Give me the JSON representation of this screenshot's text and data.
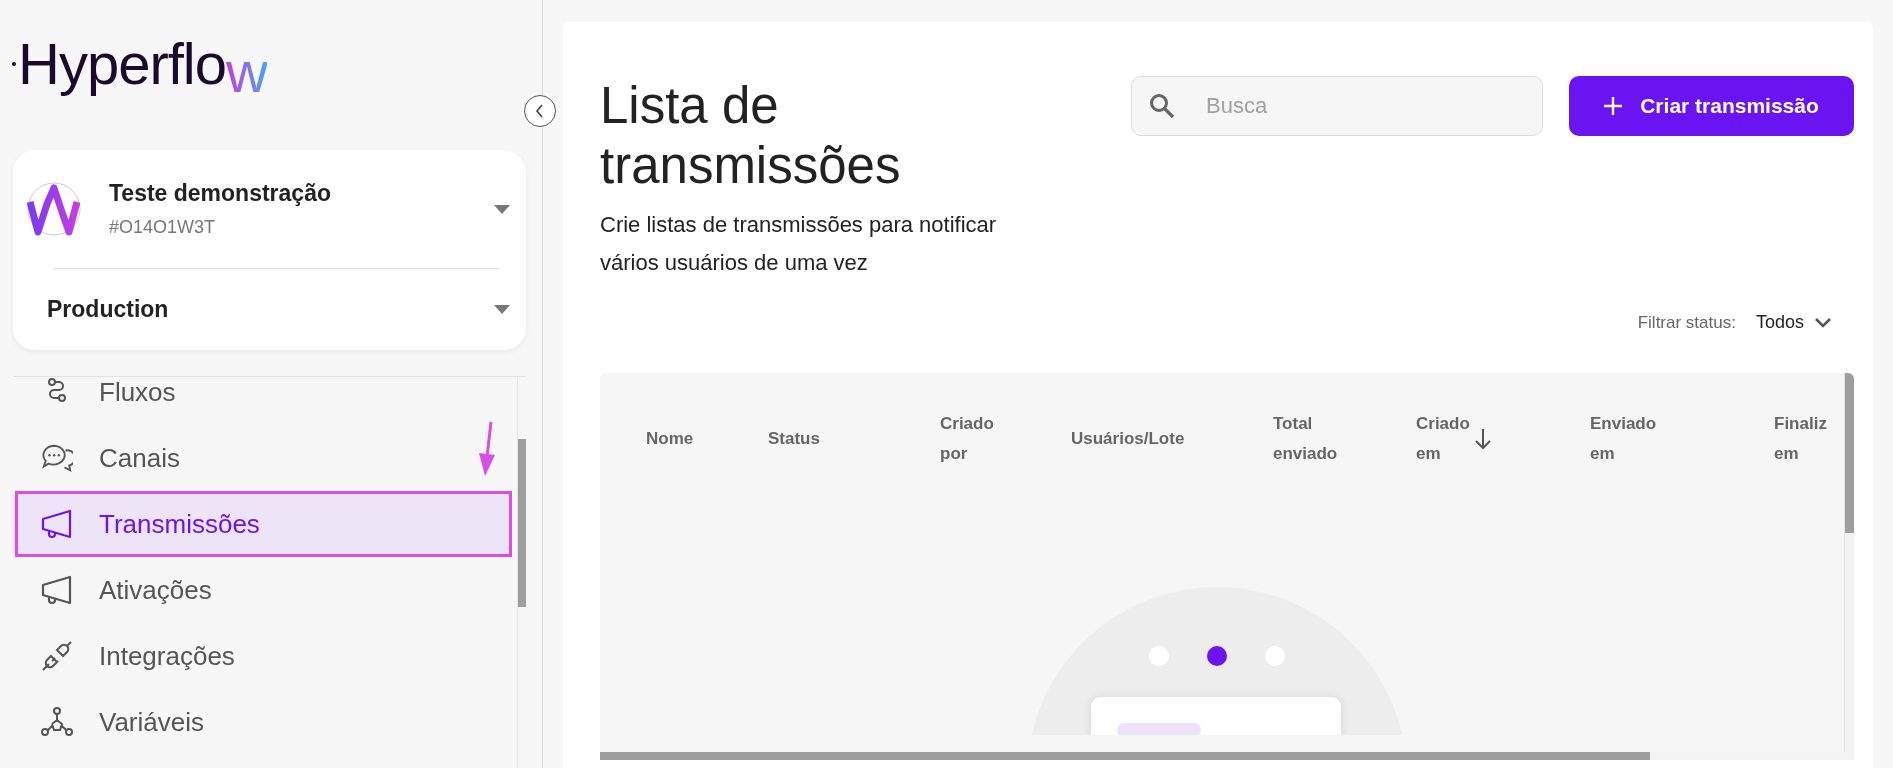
{
  "logo": {
    "text": "Hyperflow"
  },
  "organization": {
    "name": "Teste demonstração",
    "code": "#O14O1W3T",
    "environment": "Production"
  },
  "nav": [
    {
      "label": "Fluxos",
      "kind": "flow",
      "selected": false,
      "annotated": false
    },
    {
      "label": "Canais",
      "kind": "chat",
      "selected": false,
      "annotated": false
    },
    {
      "label": "Transmissões",
      "kind": "megaphone",
      "selected": true,
      "annotated": true
    },
    {
      "label": "Ativações",
      "kind": "megaphone",
      "selected": false,
      "annotated": false
    },
    {
      "label": "Integrações",
      "kind": "plug",
      "selected": false,
      "annotated": false
    },
    {
      "label": "Variáveis",
      "kind": "nodes",
      "selected": false,
      "annotated": false
    }
  ],
  "page": {
    "title": "Lista de transmissões",
    "subtitle": "Crie listas de transmissões para notificar vários usuários de uma vez"
  },
  "search": {
    "placeholder": "Busca"
  },
  "create_button": {
    "label": "Criar transmissão"
  },
  "filter": {
    "label": "Filtrar status:",
    "value": "Todos"
  },
  "table": {
    "columns": [
      {
        "label": "Nome",
        "sorted": false
      },
      {
        "label": "Status",
        "sorted": false
      },
      {
        "label": "Criado por",
        "sorted": false
      },
      {
        "label": "Usuários/Lote",
        "sorted": false
      },
      {
        "label": "Total enviado",
        "sorted": false
      },
      {
        "label": "Criado em",
        "sorted": true
      },
      {
        "label": "Enviado em",
        "sorted": false
      },
      {
        "label": "Finaliz em",
        "sorted": false
      }
    ]
  },
  "empty_state": {
    "dots": [
      {
        "selected": false
      },
      {
        "selected": true
      },
      {
        "selected": false
      }
    ]
  }
}
